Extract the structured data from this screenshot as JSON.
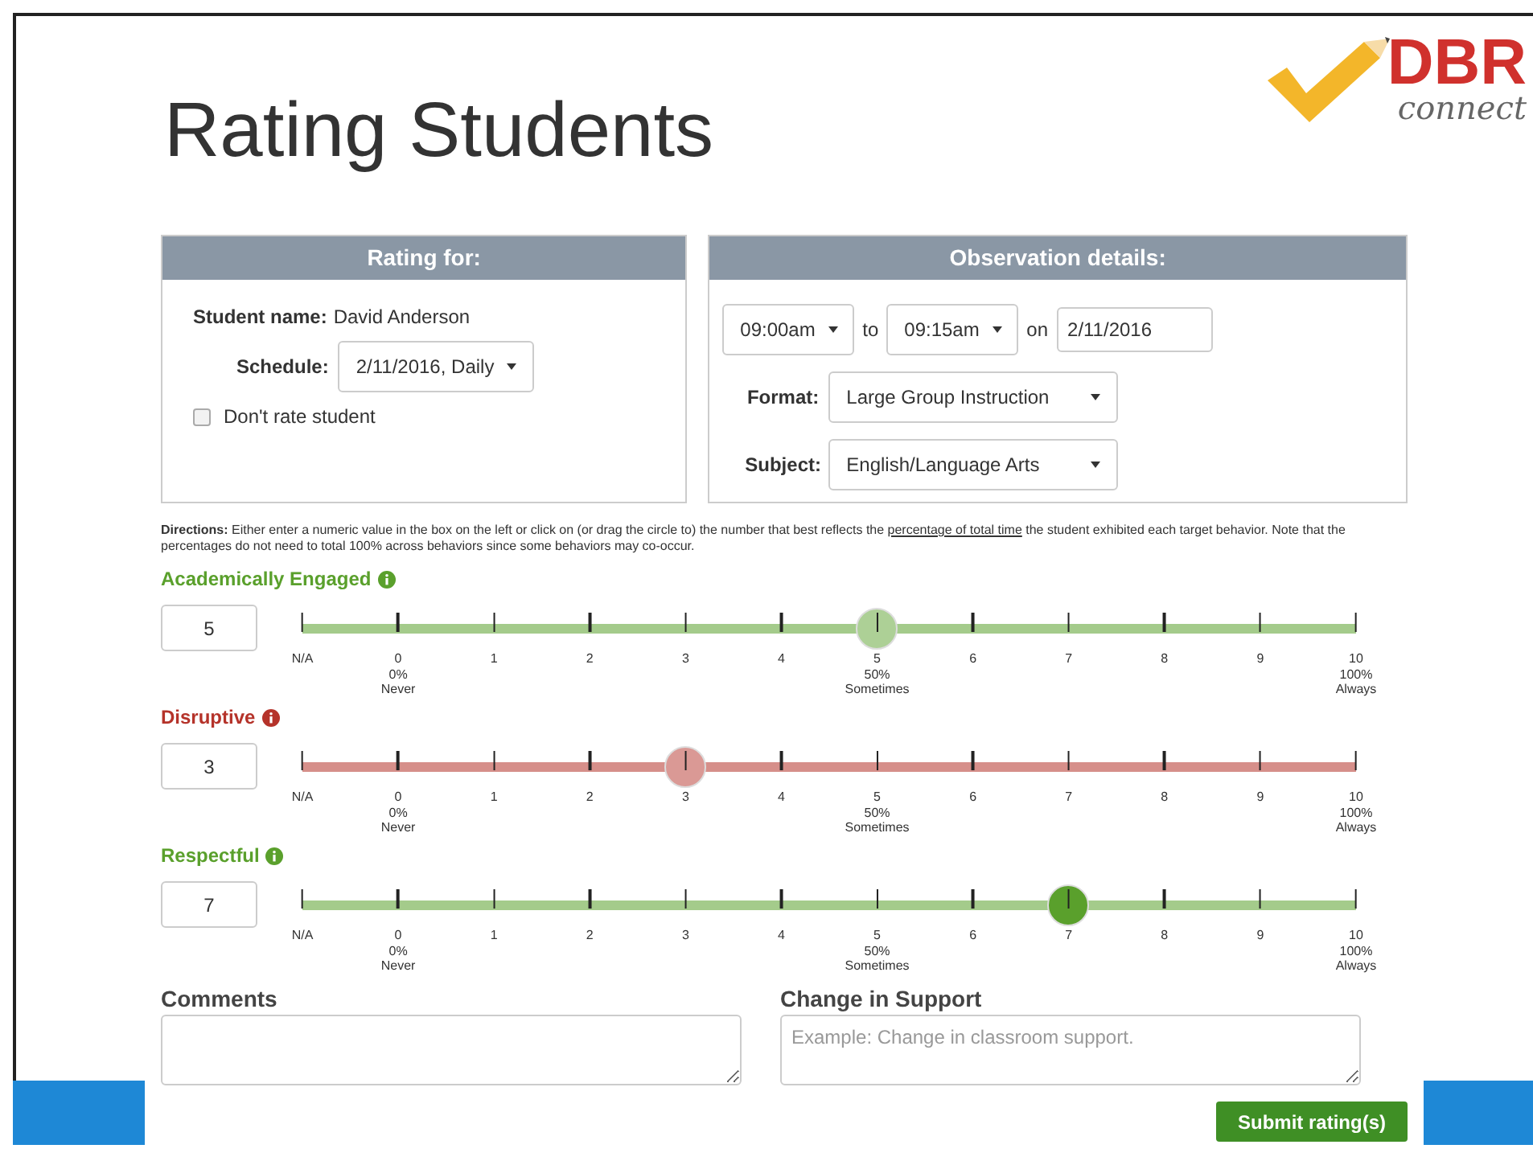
{
  "slide_title": "Rating Students",
  "logo": {
    "word": "DBR",
    "tagline": "connect"
  },
  "rating_for": {
    "header": "Rating for:",
    "student_label": "Student name:",
    "student_name": "David Anderson",
    "schedule_label": "Schedule:",
    "schedule_value": "2/11/2016, Daily",
    "dont_rate": {
      "label": "Don't rate student",
      "checked": false
    }
  },
  "observation": {
    "header": "Observation details:",
    "start": "09:00am",
    "to": "to",
    "end": "09:15am",
    "on": "on",
    "date": "2/11/2016",
    "format_label": "Format:",
    "format_value": "Large Group Instruction",
    "subject_label": "Subject:",
    "subject_value": "English/Language Arts"
  },
  "directions": "**Directions:** Either enter a numeric value in the box on the left or click on (or drag the circle to) the number that best reflects the ",
  "directions_link": "percentage of total time",
  "directions_end": " the student exhibited each target behavior. Note that the percentages do not need to total 100% across behaviors since some behaviors may co-occur.",
  "behaviors": [
    {
      "name": "Academically Engaged",
      "value": "5",
      "level": 0.5455,
      "color": "#5aa02c",
      "dark_thumb": false,
      "ticks": [
        {
          "label": "N/A"
        },
        {
          "label": "0",
          "sub": "0%",
          "word": "Never"
        },
        {
          "label": "1"
        },
        {
          "label": "2"
        },
        {
          "label": "3"
        },
        {
          "label": "4"
        },
        {
          "label": "5",
          "sub": "50%",
          "word": "Sometimes"
        },
        {
          "label": "6"
        },
        {
          "label": "7"
        },
        {
          "label": "8"
        },
        {
          "label": "9"
        },
        {
          "label": "10",
          "sub": "100%",
          "word": "Always"
        }
      ]
    },
    {
      "name": "Disruptive",
      "value": "3",
      "level": 0.3636,
      "color": "#b5332a",
      "dark_thumb": false,
      "ticks": [
        {
          "label": "N/A"
        },
        {
          "label": "0",
          "sub": "0%",
          "word": "Never"
        },
        {
          "label": "1"
        },
        {
          "label": "2"
        },
        {
          "label": "3"
        },
        {
          "label": "4"
        },
        {
          "label": "5",
          "sub": "50%",
          "word": "Sometimes"
        },
        {
          "label": "6"
        },
        {
          "label": "7"
        },
        {
          "label": "8"
        },
        {
          "label": "9"
        },
        {
          "label": "10",
          "sub": "100%",
          "word": "Always"
        }
      ]
    },
    {
      "name": "Respectful",
      "value": "7",
      "level": 0.7273,
      "color": "#5aa02c",
      "dark_thumb": true,
      "ticks": [
        {
          "label": "N/A"
        },
        {
          "label": "0",
          "sub": "0%",
          "word": "Never"
        },
        {
          "label": "1"
        },
        {
          "label": "2"
        },
        {
          "label": "3"
        },
        {
          "label": "4"
        },
        {
          "label": "5",
          "sub": "50%",
          "word": "Sometimes"
        },
        {
          "label": "6"
        },
        {
          "label": "7"
        },
        {
          "label": "8"
        },
        {
          "label": "9"
        },
        {
          "label": "10",
          "sub": "100%",
          "word": "Always"
        }
      ]
    }
  ],
  "comments": {
    "label": "Comments"
  },
  "support": {
    "label": "Change in Support",
    "placeholder": "Example: Change in classroom support."
  },
  "submit": "Submit rating(s)"
}
